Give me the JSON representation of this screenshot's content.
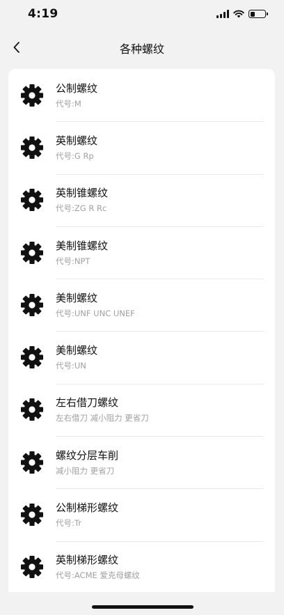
{
  "status_bar": {
    "time": "4:19",
    "signal_icon": "cellular-signal-icon",
    "wifi_icon": "wifi-icon",
    "battery_icon": "battery-icon",
    "battery_level": 0.3
  },
  "nav": {
    "title": "各种螺纹",
    "back_icon": "chevron-left-icon"
  },
  "items": [
    {
      "title": "公制螺纹",
      "subtitle": "代号:M",
      "icon": "gear-icon"
    },
    {
      "title": "英制螺纹",
      "subtitle": "代号:G Rp",
      "icon": "gear-icon"
    },
    {
      "title": "英制锥螺纹",
      "subtitle": "代号:ZG R Rc",
      "icon": "gear-icon"
    },
    {
      "title": "美制锥螺纹",
      "subtitle": "代号:NPT",
      "icon": "gear-icon"
    },
    {
      "title": "美制螺纹",
      "subtitle": "代号:UNF UNC UNEF",
      "icon": "gear-icon"
    },
    {
      "title": "美制螺纹",
      "subtitle": "代号:UN",
      "icon": "gear-icon"
    },
    {
      "title": "左右借刀螺纹",
      "subtitle": "左右借刀 减小阻力 更省刀",
      "icon": "gear-icon"
    },
    {
      "title": "螺纹分层车削",
      "subtitle": "减小阻力 更省刀",
      "icon": "gear-icon"
    },
    {
      "title": "公制梯形螺纹",
      "subtitle": "代号:Tr",
      "icon": "gear-icon"
    },
    {
      "title": "英制梯形螺纹",
      "subtitle": "代号:ACME 爱克母螺纹",
      "icon": "gear-icon"
    }
  ]
}
